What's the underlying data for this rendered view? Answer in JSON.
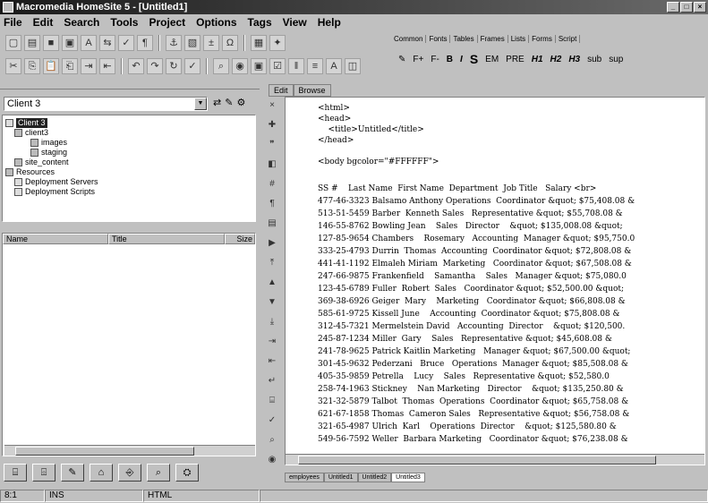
{
  "window": {
    "title": "Macromedia HomeSite 5 - [Untitled1]"
  },
  "menu": [
    "File",
    "Edit",
    "Search",
    "Tools",
    "Project",
    "Options",
    "Tags",
    "View",
    "Help"
  ],
  "tag_toolbar": {
    "tabs": [
      "Common",
      "Fonts",
      "Tables",
      "Frames",
      "Lists",
      "Forms",
      "Script"
    ],
    "buttons": [
      "F+",
      "F-",
      "B",
      "I",
      "S",
      "EM",
      "PRE",
      "H1",
      "H2",
      "H3",
      "sub",
      "sup"
    ]
  },
  "resources": {
    "combo_value": "Client 3",
    "tree": [
      "Client 3",
      "client3",
      "images",
      "staging",
      "site_content",
      "Resources",
      "Deployment Servers",
      "Deployment Scripts"
    ],
    "columns": [
      "Name",
      "Title",
      "Size"
    ]
  },
  "editor": {
    "tabs": [
      "Edit",
      "Browse"
    ],
    "lines": [
      "<html>",
      "<head>",
      "    <title>Untitled</title>",
      "</head>",
      "",
      "<body bgcolor=\"#FFFFFF\">",
      "",
      "SS #    Last Name  First Name  Department  Job Title   Salary <br>",
      "477-46-3323 Balsamo Anthony Operations  Coordinator &quot; $75,408.08 &",
      "513-51-5459 Barber  Kenneth Sales   Representative &quot; $55,708.08 &",
      "146-55-8762 Bowling Jean    Sales   Director    &quot; $135,008.08 &quot;",
      "127-85-9654 Chambers    Rosemary   Accounting  Manager &quot; $95,750.0",
      "333-25-4793 Durrin  Thomas  Accounting  Coordinator &quot; $72,808.08 &",
      "441-41-1192 Elmaleh Miriam  Marketing   Coordinator &quot; $67,508.08 &",
      "247-66-9875 Frankenfield    Samantha    Sales   Manager &quot; $75,080.0",
      "123-45-6789 Fuller  Robert  Sales   Coordinator &quot; $52,500.00 &quot;",
      "369-38-6926 Geiger  Mary    Marketing   Coordinator &quot; $66,808.08 &",
      "585-61-9725 Kissell June    Accounting  Coordinator &quot; $75,808.08 &",
      "312-45-7321 Mermelstein David   Accounting  Director    &quot; $120,500.",
      "245-87-1234 Miller  Gary    Sales   Representative &quot; $45,608.08 &",
      "241-78-9625 Patrick Kaitlin Marketing   Manager &quot; $67,500.00 &quot;",
      "301-45-9632 Pederzani   Bruce   Operations  Manager &quot; $85,508.08 &",
      "405-35-9859 Petrella    Lucy    Sales   Representative &quot; $52,580.0",
      "258-74-1963 Stickney    Nan Marketing   Director    &quot; $135,250.80 &",
      "321-32-5879 Talbot  Thomas  Operations  Coordinator &quot; $65,758.08 &",
      "621-67-1858 Thomas  Cameron Sales   Representative &quot; $56,758.08 &",
      "321-65-4987 Ulrich  Karl    Operations  Director    &quot; $125,580.80 &",
      "549-56-7592 Weller  Barbara Marketing   Coordinator &quot; $76,238.08 &"
    ],
    "doc_tabs": [
      "employees",
      "Untitled1",
      "Untitled2",
      "Untitled3"
    ]
  },
  "status": {
    "position": "8:1",
    "mode": "INS",
    "doctype": "HTML"
  }
}
